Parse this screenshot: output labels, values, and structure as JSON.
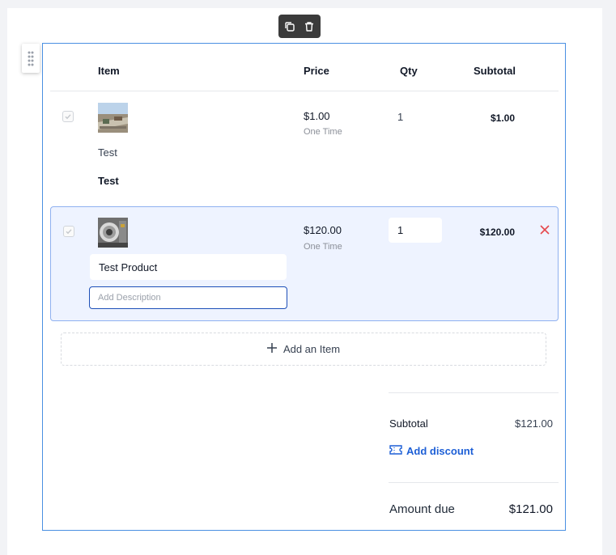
{
  "table": {
    "headers": {
      "item": "Item",
      "price": "Price",
      "qty": "Qty",
      "subtotal": "Subtotal"
    }
  },
  "rows": [
    {
      "name_primary": "Test",
      "name_secondary": "Test",
      "price": "$1.00",
      "frequency": "One Time",
      "qty": "1",
      "subtotal": "$1.00"
    },
    {
      "name": "Test Product",
      "description_placeholder": "Add Description",
      "price": "$120.00",
      "frequency": "One Time",
      "qty": "1",
      "subtotal": "$120.00"
    }
  ],
  "add_item_label": "Add an Item",
  "summary": {
    "subtotal_label": "Subtotal",
    "subtotal_value": "$121.00",
    "add_discount_label": "Add discount",
    "amount_due_label": "Amount due",
    "amount_due_value": "$121.00"
  },
  "icons": {
    "toolbar": [
      "duplicate-icon",
      "trash-icon"
    ],
    "drag": "drag-handle-icon",
    "remove": "close-icon",
    "discount": "ticket-icon",
    "add": "plus-icon"
  },
  "colors": {
    "accent": "#1d5fd6",
    "remove": "#e5484d",
    "selected_row_bg": "#eef3ff",
    "block_border": "#4a90e2"
  }
}
